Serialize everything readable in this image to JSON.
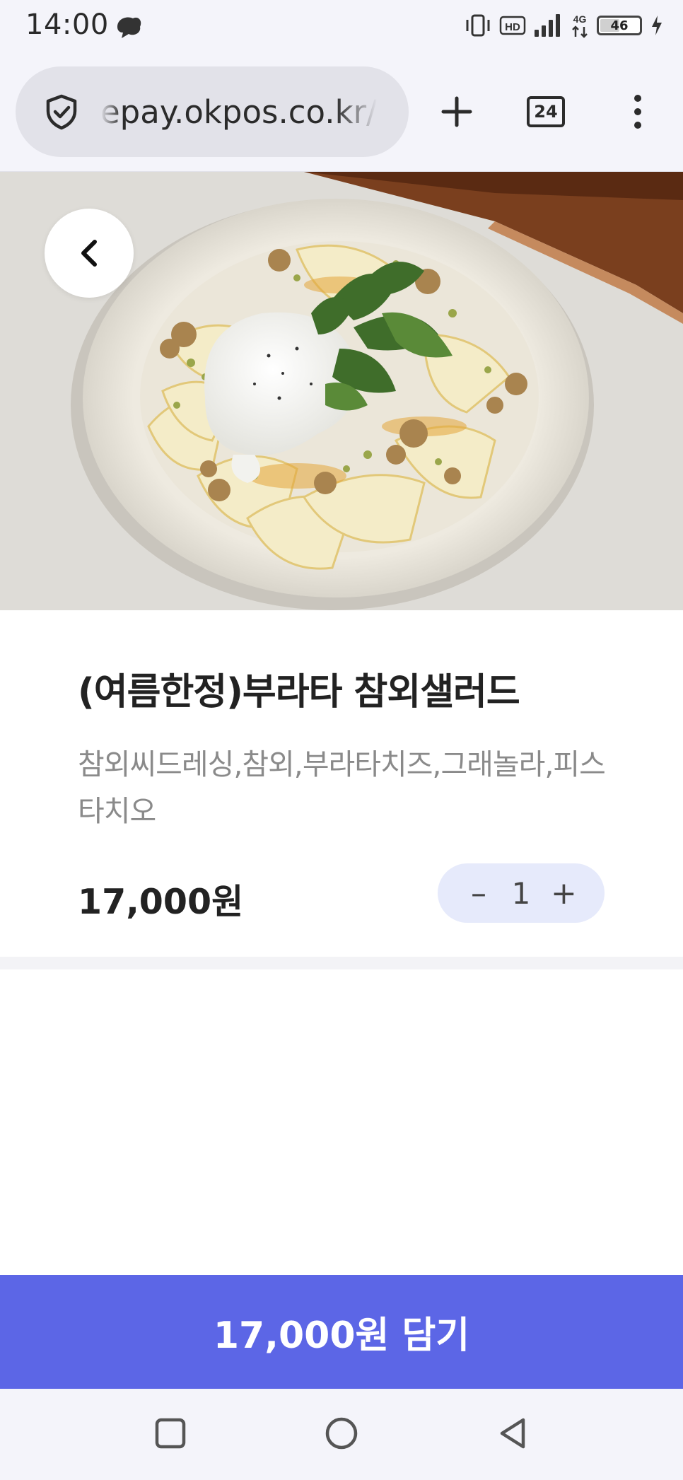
{
  "status_bar": {
    "time": "14:00",
    "network_badge": "HD",
    "network_type": "4G",
    "battery": "46"
  },
  "browser": {
    "url": "epay.okpos.co.kr/",
    "tab_count": "24"
  },
  "item": {
    "title": "(여름한정)부라타 참외샐러드",
    "description": "참외씨드레싱,참외,부라타치즈,그래놀라,피스타치오",
    "price": "17,000원",
    "quantity": "1",
    "decrement_label": "–",
    "increment_label": "+"
  },
  "cta": {
    "label": "17,000원 담기"
  },
  "colors": {
    "accent": "#5c66e6",
    "stepper_bg": "#e6eafb"
  }
}
